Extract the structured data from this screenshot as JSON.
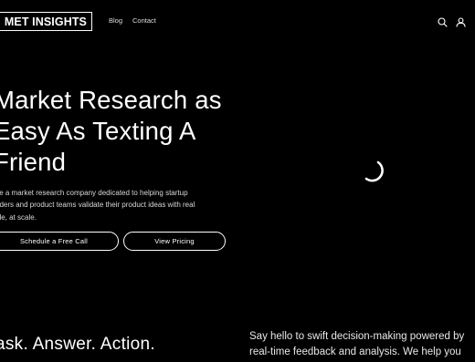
{
  "header": {
    "logo": "MET INSIGHTS",
    "nav": [
      "Blog",
      "Contact"
    ],
    "icons": [
      "search-icon",
      "account-icon"
    ]
  },
  "hero": {
    "title_lines": [
      "Market Research as",
      "Easy As Texting A",
      "Friend"
    ],
    "subtitle_lines": [
      "'re a market research company dedicated to helping startup",
      "nders and product teams validate their product ideas with real",
      "ple, at scale."
    ],
    "buttons": {
      "call": "Schedule a Free Call",
      "pricing": "View Pricing"
    }
  },
  "section": {
    "tagline": "ask. Answer. Action.",
    "description_lines": [
      "Say hello to swift decision-making powered by",
      "real-time feedback and analysis. We help you"
    ]
  },
  "colors": {
    "background": "#000000",
    "text": "#ffffff"
  }
}
